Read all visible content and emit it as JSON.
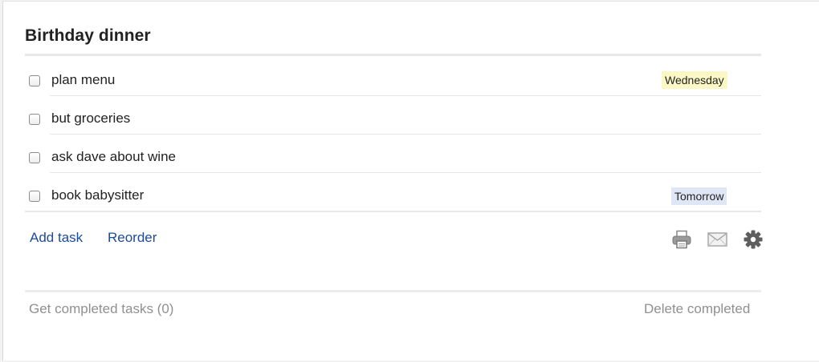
{
  "list": {
    "title": "Birthday dinner",
    "tasks": [
      {
        "text": "plan menu",
        "due": "Wednesday",
        "due_color": "#fbf8c6"
      },
      {
        "text": "but groceries",
        "due": ""
      },
      {
        "text": "ask dave about wine",
        "due": ""
      },
      {
        "text": "book babysitter",
        "due": "Tomorrow",
        "due_color": "#dfe7f7"
      }
    ]
  },
  "actions": {
    "add_task": "Add task",
    "reorder": "Reorder",
    "icons": [
      "print-icon",
      "email-icon",
      "gear-icon"
    ]
  },
  "footer": {
    "completed": "Get completed tasks (0)",
    "delete_completed": "Delete completed"
  },
  "colors": {
    "link": "#1c4a9c",
    "muted_text": "#909090"
  }
}
